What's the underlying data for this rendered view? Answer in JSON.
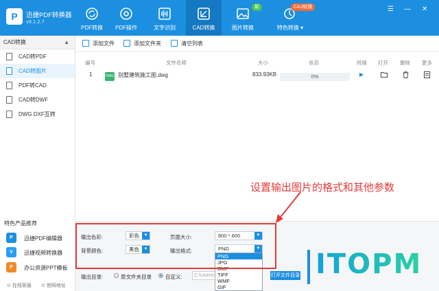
{
  "app": {
    "name": "迅捷PDF转换器",
    "version": "v9.1.2.7"
  },
  "nav": {
    "tabs": [
      {
        "label": "PDF转换",
        "icon": "refresh-icon"
      },
      {
        "label": "PDF操作",
        "icon": "settings-circle-icon"
      },
      {
        "label": "文字识别",
        "icon": "waveform-icon"
      },
      {
        "label": "CAD转换",
        "icon": "cad-icon",
        "active": true
      },
      {
        "label": "图片转换",
        "icon": "image-icon",
        "badge": "新"
      },
      {
        "label": "特色转换",
        "icon": "feature-icon",
        "badge": "CAJ转换",
        "dropdown": "▾"
      }
    ]
  },
  "sidebar": {
    "header": "CAD转换",
    "collapse_icon": "▲",
    "items": [
      {
        "label": "CAD转PDF"
      },
      {
        "label": "CAD转图片",
        "active": true
      },
      {
        "label": "PDF转CAD"
      },
      {
        "label": "CAD转DWF"
      },
      {
        "label": "DWG DXF互转"
      }
    ],
    "featured_title": "特色产品推荐",
    "featured": [
      {
        "label": "迅捷PDF编辑器",
        "icon_text": "P"
      },
      {
        "label": "迅捷视频转换器",
        "icon_text": "V"
      },
      {
        "label": "办公资源PPT模板",
        "icon_text": "P"
      }
    ],
    "footer": {
      "service": "在线客服",
      "website": "官网地址"
    }
  },
  "toolbar": {
    "add_file": "添加文件",
    "add_folder": "添加文件夹",
    "clear_list": "清空列表"
  },
  "table": {
    "columns": [
      "编号",
      "文件名称",
      "大小",
      "状态",
      "转换",
      "打开",
      "删除",
      "更多"
    ],
    "rows": [
      {
        "index": "1",
        "file_icon": "DWG",
        "name": "别墅建筑施工图.dwg",
        "size": "833.93KB",
        "status": "0%"
      }
    ]
  },
  "settings": {
    "color_label": "输出色彩:",
    "color_value": "彩色",
    "page_size_label": "页面大小:",
    "page_size_value": "800 * 600",
    "bg_label": "背景颜色:",
    "bg_value": "黑色",
    "format_label": "输出格式:",
    "format_value": "PNG",
    "format_options": [
      "PNG",
      "JPG",
      "BMP",
      "TIFF",
      "WMF",
      "GIF"
    ],
    "output_dir_label": "输出目录:",
    "radio_original": "原文件夹目录",
    "radio_custom": "自定义:",
    "custom_path": "C:\\Users\\",
    "open_folder_button": "打开文件目录"
  },
  "annotation": {
    "text": "设置输出图片的格式和其他参数",
    "color": "#e23b3b"
  },
  "watermark": "ITOPM",
  "colors": {
    "primary": "#1c8fe0",
    "badge_new": "#4cc25a",
    "badge_caj": "#f26b3a"
  }
}
